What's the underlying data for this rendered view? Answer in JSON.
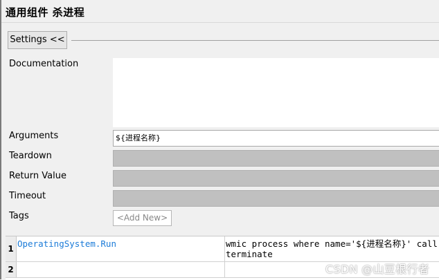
{
  "title": "通用组件 杀进程",
  "settings_button": "Settings <<",
  "fields": {
    "documentation_label": "Documentation",
    "documentation_value": "",
    "arguments_label": "Arguments",
    "arguments_value": "${进程名称}",
    "teardown_label": "Teardown",
    "return_value_label": "Return Value",
    "timeout_label": "Timeout",
    "tags_label": "Tags",
    "add_new_tag": "<Add New>"
  },
  "grid": {
    "rows": [
      {
        "num": "1",
        "keyword": "OperatingSystem.Run",
        "arg": "wmic process where name='${进程名称}' call terminate"
      },
      {
        "num": "2",
        "keyword": "",
        "arg": ""
      }
    ]
  },
  "watermark": "CSDN @山豆根行者",
  "colors": {
    "keyword": "#1b7bd8",
    "disabled_field": "#c0c0c0"
  }
}
